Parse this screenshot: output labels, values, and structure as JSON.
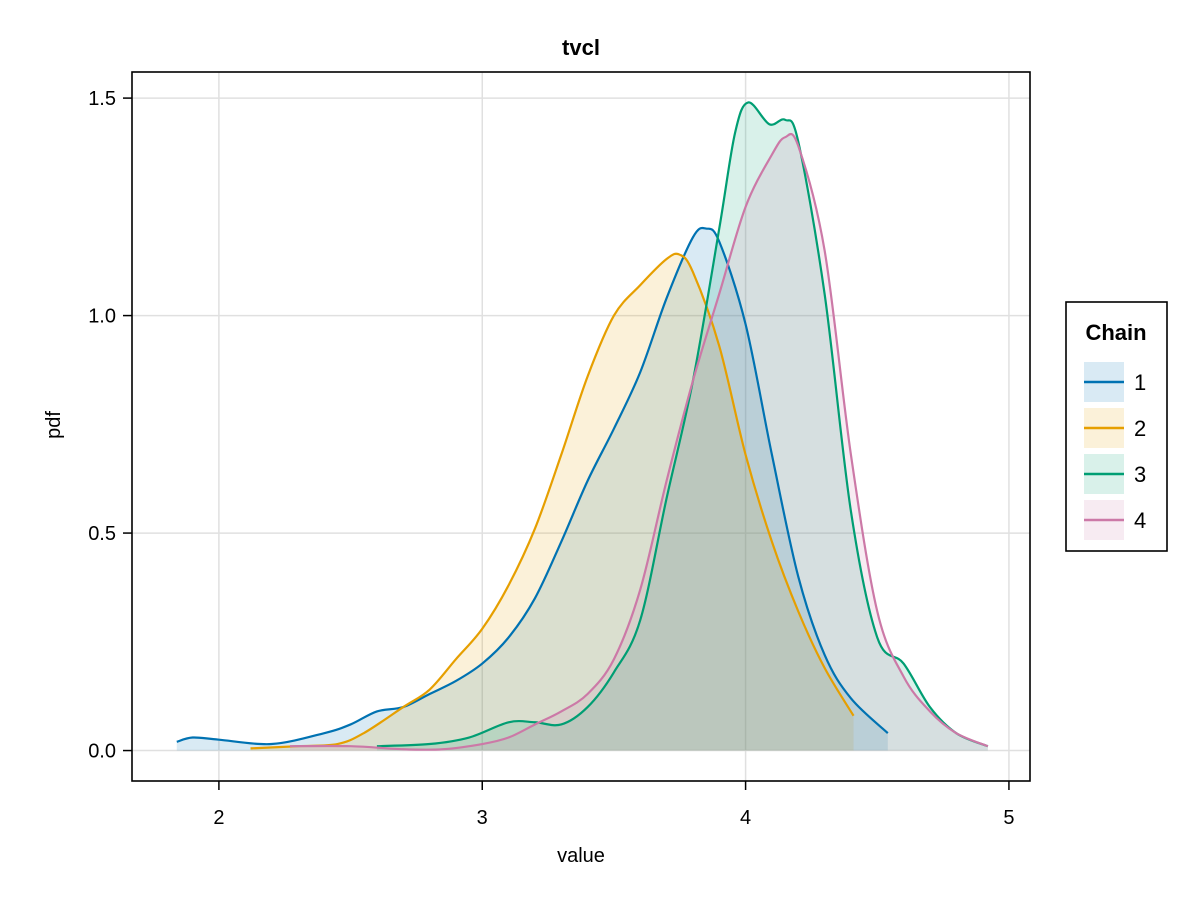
{
  "chart_data": {
    "type": "area",
    "title": "tvcl",
    "xlabel": "value",
    "ylabel": "pdf",
    "xlim": [
      1.67,
      5.08
    ],
    "ylim": [
      -0.07,
      1.56
    ],
    "xticks": [
      2,
      3,
      4,
      5
    ],
    "xtick_labels": [
      "2",
      "3",
      "4",
      "5"
    ],
    "yticks": [
      0.0,
      0.5,
      1.0,
      1.5
    ],
    "ytick_labels": [
      "0.0",
      "0.5",
      "1.0",
      "1.5"
    ],
    "grid": true,
    "legend": {
      "title": "Chain",
      "placement": "right"
    },
    "series": [
      {
        "name": "1",
        "color": "#0072b2",
        "fill": "#0072b2",
        "x": [
          1.84,
          1.9,
          2.0,
          2.2,
          2.4,
          2.5,
          2.6,
          2.7,
          2.8,
          2.9,
          3.0,
          3.1,
          3.2,
          3.3,
          3.4,
          3.5,
          3.6,
          3.7,
          3.8,
          3.85,
          3.9,
          4.0,
          4.1,
          4.2,
          4.3,
          4.4,
          4.54
        ],
        "y": [
          0.02,
          0.03,
          0.025,
          0.015,
          0.04,
          0.06,
          0.09,
          0.1,
          0.13,
          0.16,
          0.2,
          0.26,
          0.35,
          0.48,
          0.62,
          0.74,
          0.87,
          1.04,
          1.18,
          1.2,
          1.17,
          0.98,
          0.68,
          0.4,
          0.22,
          0.12,
          0.04
        ]
      },
      {
        "name": "2",
        "color": "#e69f00",
        "fill": "#e69f00",
        "x": [
          2.12,
          2.3,
          2.45,
          2.55,
          2.7,
          2.8,
          2.9,
          3.0,
          3.1,
          3.2,
          3.3,
          3.4,
          3.5,
          3.6,
          3.7,
          3.75,
          3.8,
          3.9,
          4.0,
          4.1,
          4.2,
          4.3,
          4.41
        ],
        "y": [
          0.005,
          0.01,
          0.015,
          0.04,
          0.1,
          0.14,
          0.21,
          0.28,
          0.38,
          0.51,
          0.68,
          0.86,
          1.0,
          1.07,
          1.13,
          1.14,
          1.1,
          0.93,
          0.68,
          0.48,
          0.32,
          0.19,
          0.08
        ]
      },
      {
        "name": "3",
        "color": "#009e73",
        "fill": "#009e73",
        "x": [
          2.6,
          2.8,
          2.95,
          3.1,
          3.2,
          3.3,
          3.4,
          3.5,
          3.6,
          3.7,
          3.8,
          3.9,
          3.96,
          4.01,
          4.09,
          4.15,
          4.2,
          4.3,
          4.4,
          4.5,
          4.6,
          4.7,
          4.8,
          4.92
        ],
        "y": [
          0.01,
          0.015,
          0.03,
          0.065,
          0.065,
          0.06,
          0.1,
          0.18,
          0.3,
          0.58,
          0.85,
          1.2,
          1.42,
          1.49,
          1.44,
          1.45,
          1.4,
          1.05,
          0.55,
          0.26,
          0.2,
          0.1,
          0.04,
          0.01
        ]
      },
      {
        "name": "4",
        "color": "#cc79a7",
        "fill": "#cc79a7",
        "x": [
          2.27,
          2.5,
          2.7,
          2.85,
          3.0,
          3.1,
          3.2,
          3.3,
          3.4,
          3.5,
          3.6,
          3.7,
          3.8,
          3.9,
          4.0,
          4.1,
          4.15,
          4.2,
          4.3,
          4.4,
          4.5,
          4.6,
          4.7,
          4.8,
          4.92
        ],
        "y": [
          0.01,
          0.01,
          0.003,
          0.003,
          0.015,
          0.03,
          0.06,
          0.09,
          0.13,
          0.21,
          0.37,
          0.62,
          0.85,
          1.05,
          1.25,
          1.37,
          1.41,
          1.39,
          1.15,
          0.68,
          0.32,
          0.17,
          0.09,
          0.04,
          0.01
        ]
      }
    ]
  }
}
